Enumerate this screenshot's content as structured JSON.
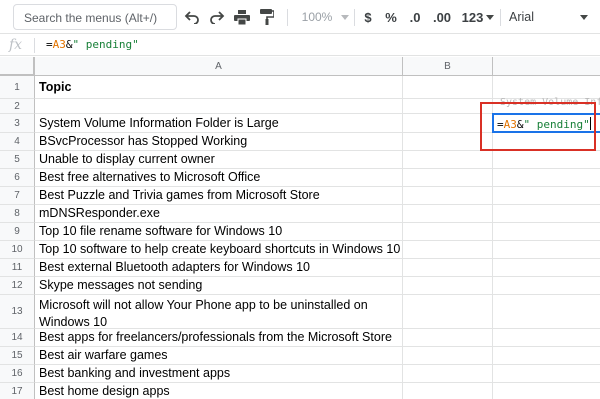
{
  "toolbar": {
    "menu_search_placeholder": "Search the menus (Alt+/)",
    "zoom": "100%",
    "currency": "$",
    "percent": "%",
    "decrease_decimals": ".0",
    "increase_decimals": ".00",
    "more_formats": "123",
    "font_family": "Arial"
  },
  "formula_bar": {
    "fx_label": "fx",
    "formula_prefix": "=",
    "formula_ref": "A3",
    "formula_op": "&",
    "formula_string": "\" pending\""
  },
  "columns": [
    "A",
    "B"
  ],
  "rows": [
    {
      "num": "1",
      "a": "Topic"
    },
    {
      "num": "2",
      "a": ""
    },
    {
      "num": "3",
      "a": "System Volume Information Folder is Large"
    },
    {
      "num": "4",
      "a": "BSvcProcessor has Stopped Working"
    },
    {
      "num": "5",
      "a": "Unable to display current owner"
    },
    {
      "num": "6",
      "a": "Best free alternatives to Microsoft Office"
    },
    {
      "num": "7",
      "a": "Best Puzzle and Trivia games from Microsoft Store"
    },
    {
      "num": "8",
      "a": "mDNSResponder.exe"
    },
    {
      "num": "9",
      "a": "Top 10 file rename software for Windows 10"
    },
    {
      "num": "10",
      "a": "Top 10 software to help create keyboard shortcuts in Windows 10"
    },
    {
      "num": "11",
      "a": "Best external Bluetooth adapters for Windows 10"
    },
    {
      "num": "12",
      "a": "Skype messages not sending"
    },
    {
      "num": "13",
      "a": "Microsoft will not allow Your Phone app to be uninstalled on Windows 10"
    },
    {
      "num": "14",
      "a": "Best apps for freelancers/professionals from the Microsoft Store"
    },
    {
      "num": "15",
      "a": "Best air warfare games"
    },
    {
      "num": "16",
      "a": "Best banking and investment apps"
    },
    {
      "num": "17",
      "a": "Best home design apps"
    }
  ],
  "c2_overflow": "System Volume Info",
  "active_cell": {
    "prefix": "=",
    "ref": "A3",
    "op": "&",
    "string": "\" pending\""
  },
  "colors": {
    "selection": "#1a73e8",
    "annotation": "#d93025",
    "reference": "#e37400",
    "string": "#188038"
  }
}
